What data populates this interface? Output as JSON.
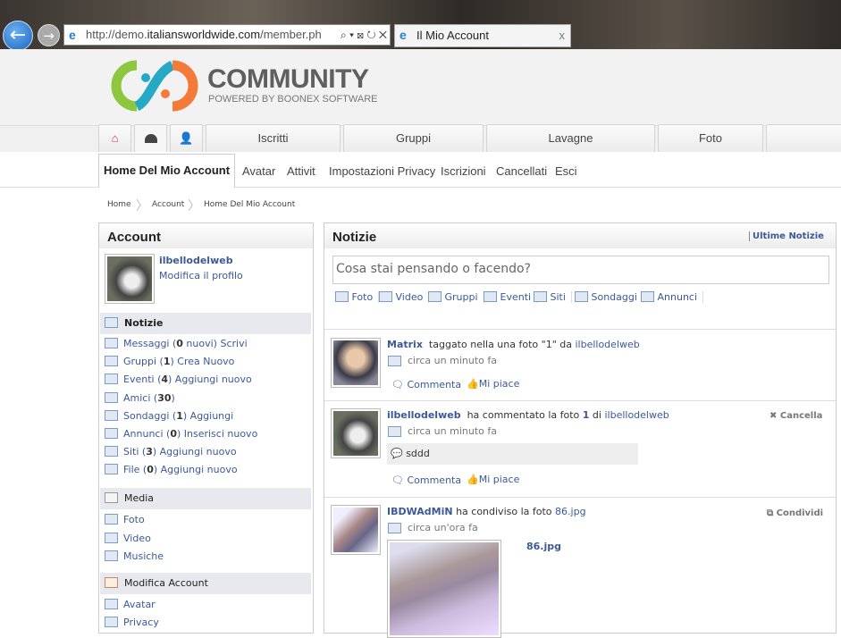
{
  "browser": {
    "url_prefix": "http://demo.",
    "url_domain": "italiansworldwide.com",
    "url_path": "/member.ph",
    "tab_title": "Il Mio Account",
    "tab_close": "x",
    "addr_tools": "⌕ ▾ ⊠ ↻ ✕"
  },
  "logo": {
    "title": "COMMUNITY",
    "subtitle": "POWERED BY BOONEX SOFTWARE"
  },
  "topnav": [
    "Iscritti",
    "Gruppi",
    "Lavagne",
    "Foto"
  ],
  "subnav": {
    "active": "Home Del Mio Account",
    "items": [
      "Avatar",
      "Attivit",
      "Impostazioni Privacy",
      "Iscrizioni",
      "Cancellati",
      "Esci"
    ]
  },
  "breadcrumb": [
    "Home",
    "Account",
    "Home Del Mio Account"
  ],
  "account": {
    "title": "Account",
    "username": "ilbellodelweb",
    "edit_profile": "Modifica il profilo",
    "sections": [
      {
        "title": "Notizie",
        "items": [
          {
            "label": "Messaggi (",
            "count": "0",
            "after": " nuovi)",
            "action": " Scrivi"
          },
          {
            "label": "Gruppi (",
            "count": "1",
            "after": ")",
            "action": " Crea Nuovo"
          },
          {
            "label": "Eventi  (",
            "count": "4",
            "after": ")",
            "action": " Aggiungi nuovo"
          },
          {
            "label": "Amici (",
            "count": "30",
            "after": ")",
            "action": ""
          },
          {
            "label": "Sondaggi (",
            "count": "1",
            "after": ")",
            "action": " Aggiungi"
          },
          {
            "label": "Annunci (",
            "count": "0",
            "after": ")",
            "action": " Inserisci nuovo"
          },
          {
            "label": "Siti (",
            "count": "3",
            "after": ")",
            "action": " Aggiungi nuovo"
          },
          {
            "label": "File (",
            "count": "0",
            "after": ")",
            "action": " Aggiungi nuovo"
          }
        ]
      },
      {
        "title": "Media",
        "items": [
          {
            "label": "Foto"
          },
          {
            "label": "Video"
          },
          {
            "label": "Musiche"
          }
        ]
      },
      {
        "title": "Modifica Account",
        "items": [
          {
            "label": "Avatar"
          },
          {
            "label": "Privacy"
          }
        ]
      }
    ]
  },
  "news": {
    "title": "Notizie",
    "latest": "Ultime Notizie",
    "placeholder": "Cosa stai pensando o facendo?",
    "post_tools": [
      "Foto",
      "Video",
      "Gruppi",
      "Eventi",
      "Siti",
      "Sondaggi",
      "Annunci"
    ],
    "feed": [
      {
        "user": "Matrix",
        "text": "taggato nella una foto \"1\" da ",
        "link": "ilbellodelweb",
        "time": "circa un minuto fa",
        "comment": "Commenta",
        "like": "Mi piace"
      },
      {
        "user": "ilbellodelweb",
        "text": "ha commentato la foto ",
        "bold": "1",
        "text2": " di ",
        "link": "ilbellodelweb",
        "time": "circa un minuto fa",
        "quote": "sddd",
        "comment": "Commenta",
        "like": "Mi piace",
        "side": "Cancella"
      },
      {
        "user": "IBDWAdMiN",
        "text": "ha condiviso la foto ",
        "link": "86.jpg",
        "time": "circa un'ora fa",
        "photo_title": "86.jpg",
        "side": "Condividi"
      }
    ]
  }
}
